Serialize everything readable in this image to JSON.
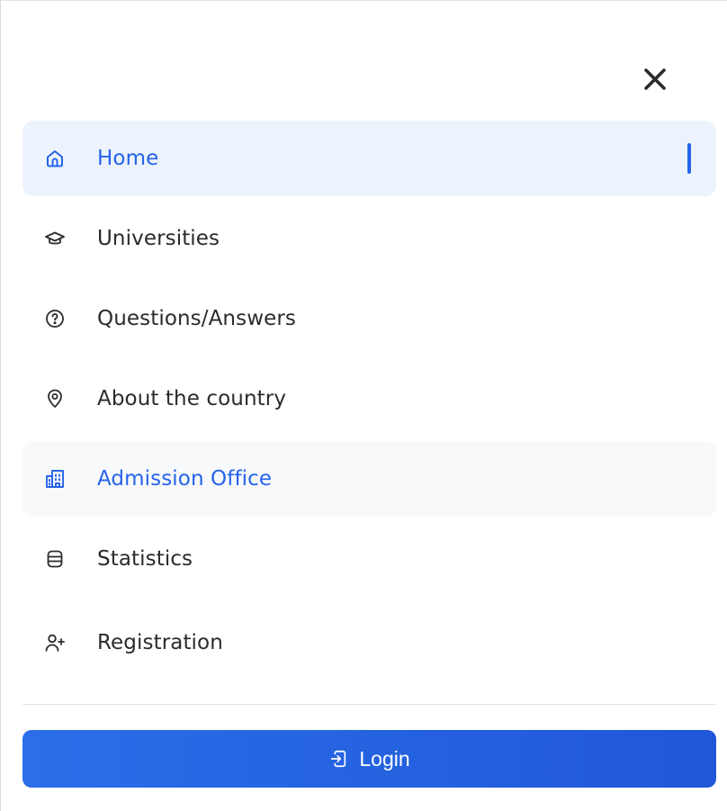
{
  "menu": {
    "close_icon": "close-icon",
    "accent_color": "#2563eb",
    "items": [
      {
        "label": "Home",
        "icon": "home-icon",
        "state": "active"
      },
      {
        "label": "Universities",
        "icon": "graduation-cap-icon",
        "state": "default"
      },
      {
        "label": "Questions/Answers",
        "icon": "question-circle-icon",
        "state": "default"
      },
      {
        "label": "About the country",
        "icon": "map-pin-icon",
        "state": "default"
      },
      {
        "label": "Admission Office",
        "icon": "building-icon",
        "state": "hover"
      },
      {
        "label": "Statistics",
        "icon": "database-icon",
        "state": "default"
      },
      {
        "label": "Registration",
        "icon": "user-plus-icon",
        "state": "default"
      }
    ]
  },
  "login": {
    "label": "Login",
    "icon": "login-icon"
  }
}
